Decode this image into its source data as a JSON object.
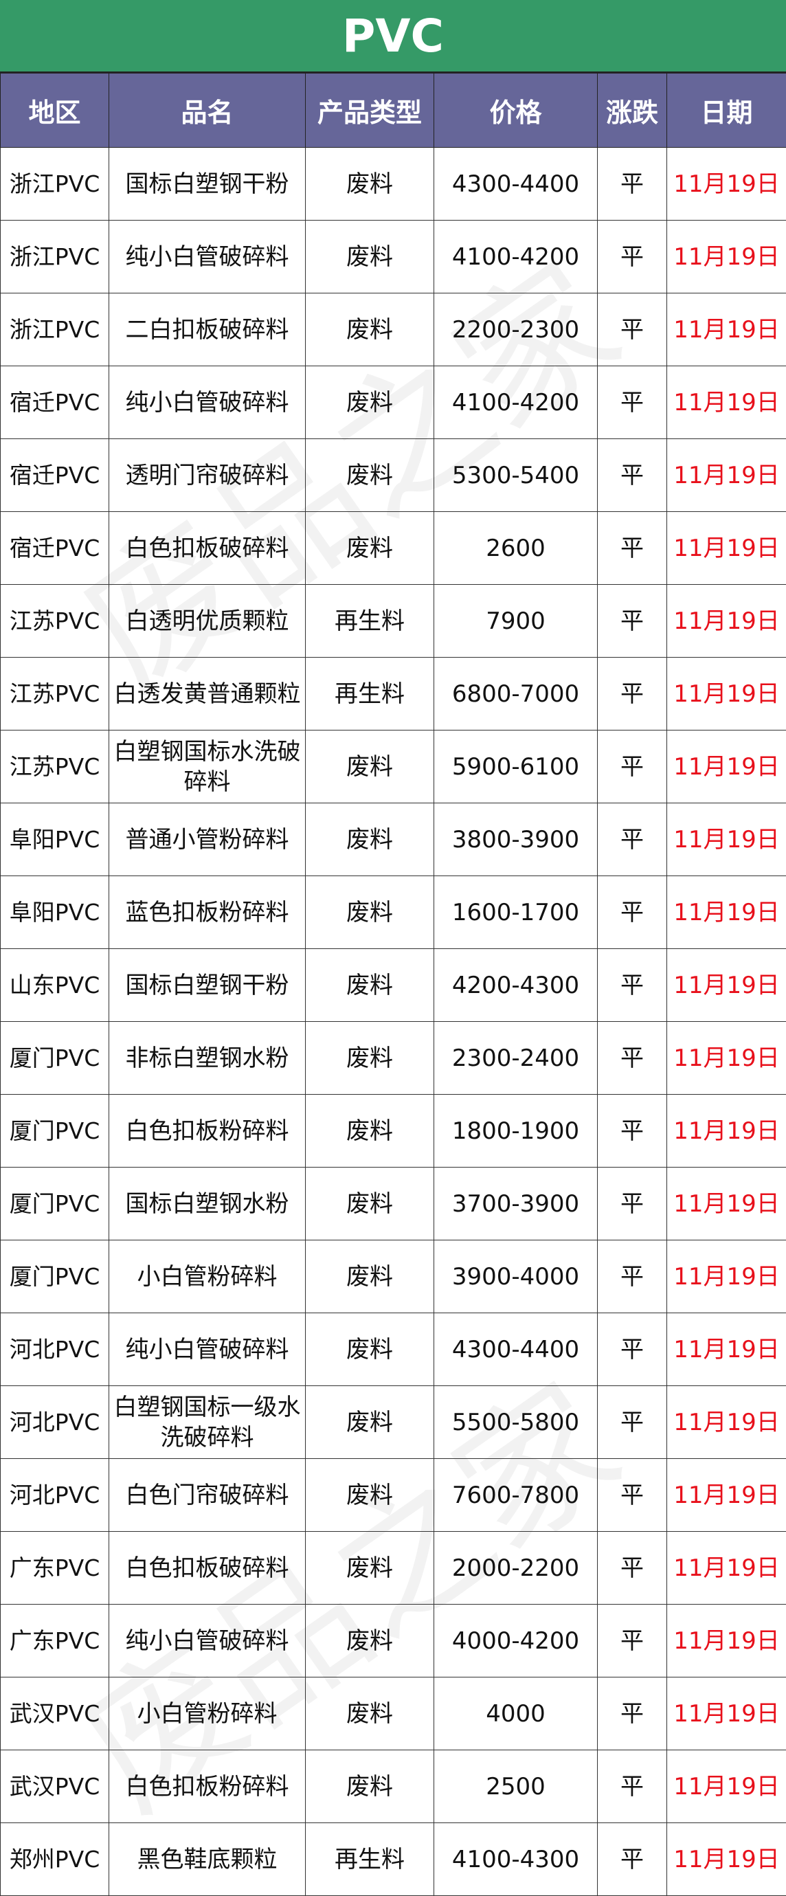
{
  "title": "PVC",
  "headers": [
    "地区",
    "品名",
    "产品类型",
    "价格",
    "涨跌",
    "日期"
  ],
  "watermark": "废品之家",
  "colors": {
    "title_bg": "#359a67",
    "header_bg": "#666699",
    "date_text": "#e8101b"
  },
  "rows": [
    {
      "region": "浙江PVC",
      "name": "国标白塑钢干粉",
      "type": "废料",
      "price": "4300-4400",
      "change": "平",
      "date": "11月19日"
    },
    {
      "region": "浙江PVC",
      "name": "纯小白管破碎料",
      "type": "废料",
      "price": "4100-4200",
      "change": "平",
      "date": "11月19日"
    },
    {
      "region": "浙江PVC",
      "name": "二白扣板破碎料",
      "type": "废料",
      "price": "2200-2300",
      "change": "平",
      "date": "11月19日"
    },
    {
      "region": "宿迁PVC",
      "name": "纯小白管破碎料",
      "type": "废料",
      "price": "4100-4200",
      "change": "平",
      "date": "11月19日"
    },
    {
      "region": "宿迁PVC",
      "name": "透明门帘破碎料",
      "type": "废料",
      "price": "5300-5400",
      "change": "平",
      "date": "11月19日"
    },
    {
      "region": "宿迁PVC",
      "name": "白色扣板破碎料",
      "type": "废料",
      "price": "2600",
      "change": "平",
      "date": "11月19日"
    },
    {
      "region": "江苏PVC",
      "name": "白透明优质颗粒",
      "type": "再生料",
      "price": "7900",
      "change": "平",
      "date": "11月19日"
    },
    {
      "region": "江苏PVC",
      "name": "白透发黄普通颗粒",
      "type": "再生料",
      "price": "6800-7000",
      "change": "平",
      "date": "11月19日"
    },
    {
      "region": "江苏PVC",
      "name": "白塑钢国标水洗破碎料",
      "type": "废料",
      "price": "5900-6100",
      "change": "平",
      "date": "11月19日"
    },
    {
      "region": "阜阳PVC",
      "name": "普通小管粉碎料",
      "type": "废料",
      "price": "3800-3900",
      "change": "平",
      "date": "11月19日"
    },
    {
      "region": "阜阳PVC",
      "name": "蓝色扣板粉碎料",
      "type": "废料",
      "price": "1600-1700",
      "change": "平",
      "date": "11月19日"
    },
    {
      "region": "山东PVC",
      "name": "国标白塑钢干粉",
      "type": "废料",
      "price": "4200-4300",
      "change": "平",
      "date": "11月19日"
    },
    {
      "region": "厦门PVC",
      "name": "非标白塑钢水粉",
      "type": "废料",
      "price": "2300-2400",
      "change": "平",
      "date": "11月19日"
    },
    {
      "region": "厦门PVC",
      "name": "白色扣板粉碎料",
      "type": "废料",
      "price": "1800-1900",
      "change": "平",
      "date": "11月19日"
    },
    {
      "region": "厦门PVC",
      "name": "国标白塑钢水粉",
      "type": "废料",
      "price": "3700-3900",
      "change": "平",
      "date": "11月19日"
    },
    {
      "region": "厦门PVC",
      "name": "小白管粉碎料",
      "type": "废料",
      "price": "3900-4000",
      "change": "平",
      "date": "11月19日"
    },
    {
      "region": "河北PVC",
      "name": "纯小白管破碎料",
      "type": "废料",
      "price": "4300-4400",
      "change": "平",
      "date": "11月19日"
    },
    {
      "region": "河北PVC",
      "name": "白塑钢国标一级水洗破碎料",
      "type": "废料",
      "price": "5500-5800",
      "change": "平",
      "date": "11月19日"
    },
    {
      "region": "河北PVC",
      "name": "白色门帘破碎料",
      "type": "废料",
      "price": "7600-7800",
      "change": "平",
      "date": "11月19日"
    },
    {
      "region": "广东PVC",
      "name": "白色扣板破碎料",
      "type": "废料",
      "price": "2000-2200",
      "change": "平",
      "date": "11月19日"
    },
    {
      "region": "广东PVC",
      "name": "纯小白管破碎料",
      "type": "废料",
      "price": "4000-4200",
      "change": "平",
      "date": "11月19日"
    },
    {
      "region": "武汉PVC",
      "name": "小白管粉碎料",
      "type": "废料",
      "price": "4000",
      "change": "平",
      "date": "11月19日"
    },
    {
      "region": "武汉PVC",
      "name": "白色扣板粉碎料",
      "type": "废料",
      "price": "2500",
      "change": "平",
      "date": "11月19日"
    },
    {
      "region": "郑州PVC",
      "name": "黑色鞋底颗粒",
      "type": "再生料",
      "price": "4100-4300",
      "change": "平",
      "date": "11月19日"
    }
  ]
}
